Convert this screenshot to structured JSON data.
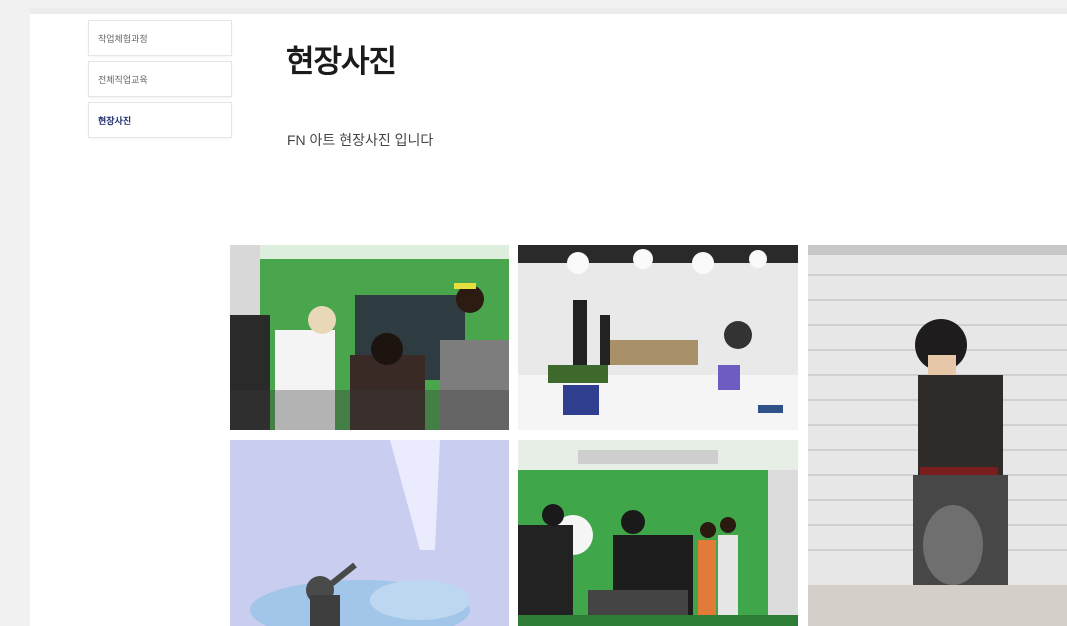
{
  "sidebar": {
    "items": [
      {
        "label": "작업체험과정"
      },
      {
        "label": "전체직업교육"
      },
      {
        "label": "현장사진",
        "active": true
      }
    ]
  },
  "main": {
    "title": "현장사진",
    "description": "FN 아트 현장사진 입니다"
  },
  "gallery": {
    "photos": [
      {
        "name": "green-screen-filming"
      },
      {
        "name": "white-studio-set"
      },
      {
        "name": "hanbok-model-portrait"
      },
      {
        "name": "blue-smoke-scene"
      },
      {
        "name": "studio-crew-lighting"
      }
    ]
  },
  "colors": {
    "active_menu": "#1c2c6e",
    "chroma_green": "#3fa64a"
  }
}
